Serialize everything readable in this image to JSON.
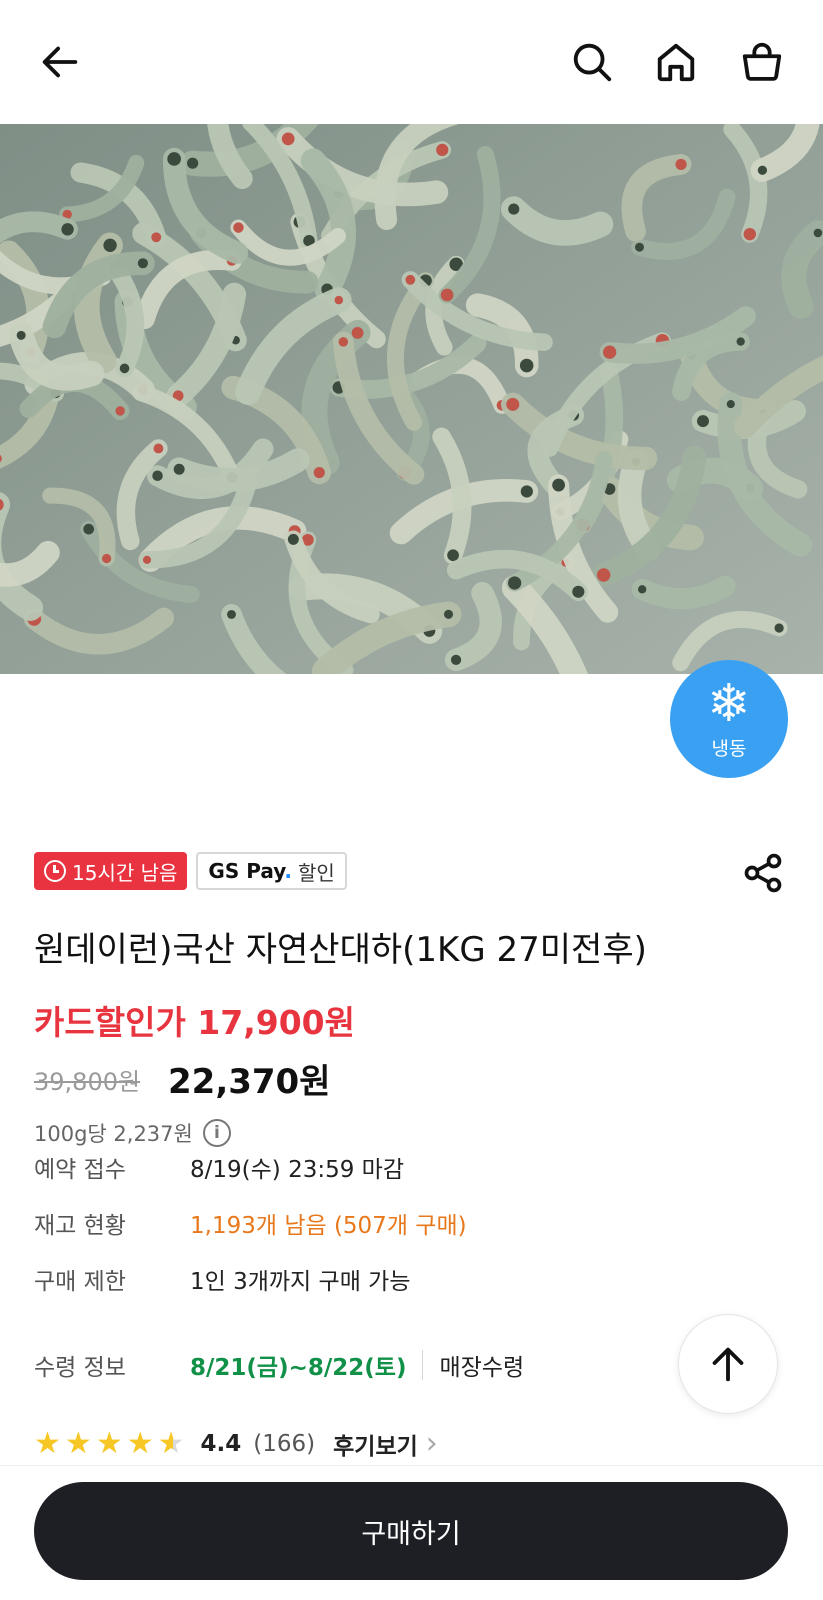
{
  "header": {
    "back_icon": "arrow-left-icon",
    "search_icon": "search-icon",
    "home_icon": "home-icon",
    "cart_icon": "shopping-bag-icon"
  },
  "product": {
    "image_description_icon": "product-photo",
    "freeze_badge": {
      "icon": "snowflake-icon",
      "label": "냉동",
      "color": "#3aa1f2"
    },
    "badges": {
      "time_left": "15시간 남음",
      "gs_pay_brand": "GS Pay",
      "gs_pay_discount": "할인"
    },
    "title": "원데이런)국산 자연산대하(1KG 27미전후)",
    "card_price": "카드할인가 17,900원",
    "original_price": "39,800원",
    "sale_price": "22,370원",
    "unit_price": "100g당 2,237원",
    "info": [
      {
        "key": "예약 접수",
        "value": "8/19(수) 23:59 마감"
      },
      {
        "key": "재고 현황",
        "value": "1,193개 남음 (507개 구매)"
      },
      {
        "key": "구매 제한",
        "value": "1인 3개까지 구매 가능"
      },
      {
        "key": "수령 정보",
        "value": "8/21(금)~8/22(토)",
        "extra": "매장수령"
      }
    ],
    "rating": {
      "stars": 4.4,
      "score": "4.4",
      "count": "(166)",
      "review_link": "후기보기"
    }
  },
  "buy_button": {
    "label": "구매하기"
  },
  "colors": {
    "accent_red": "#e8343f",
    "stock_orange": "#e8781c",
    "pickup_green": "#119148",
    "button_dark": "#1d1f24"
  }
}
